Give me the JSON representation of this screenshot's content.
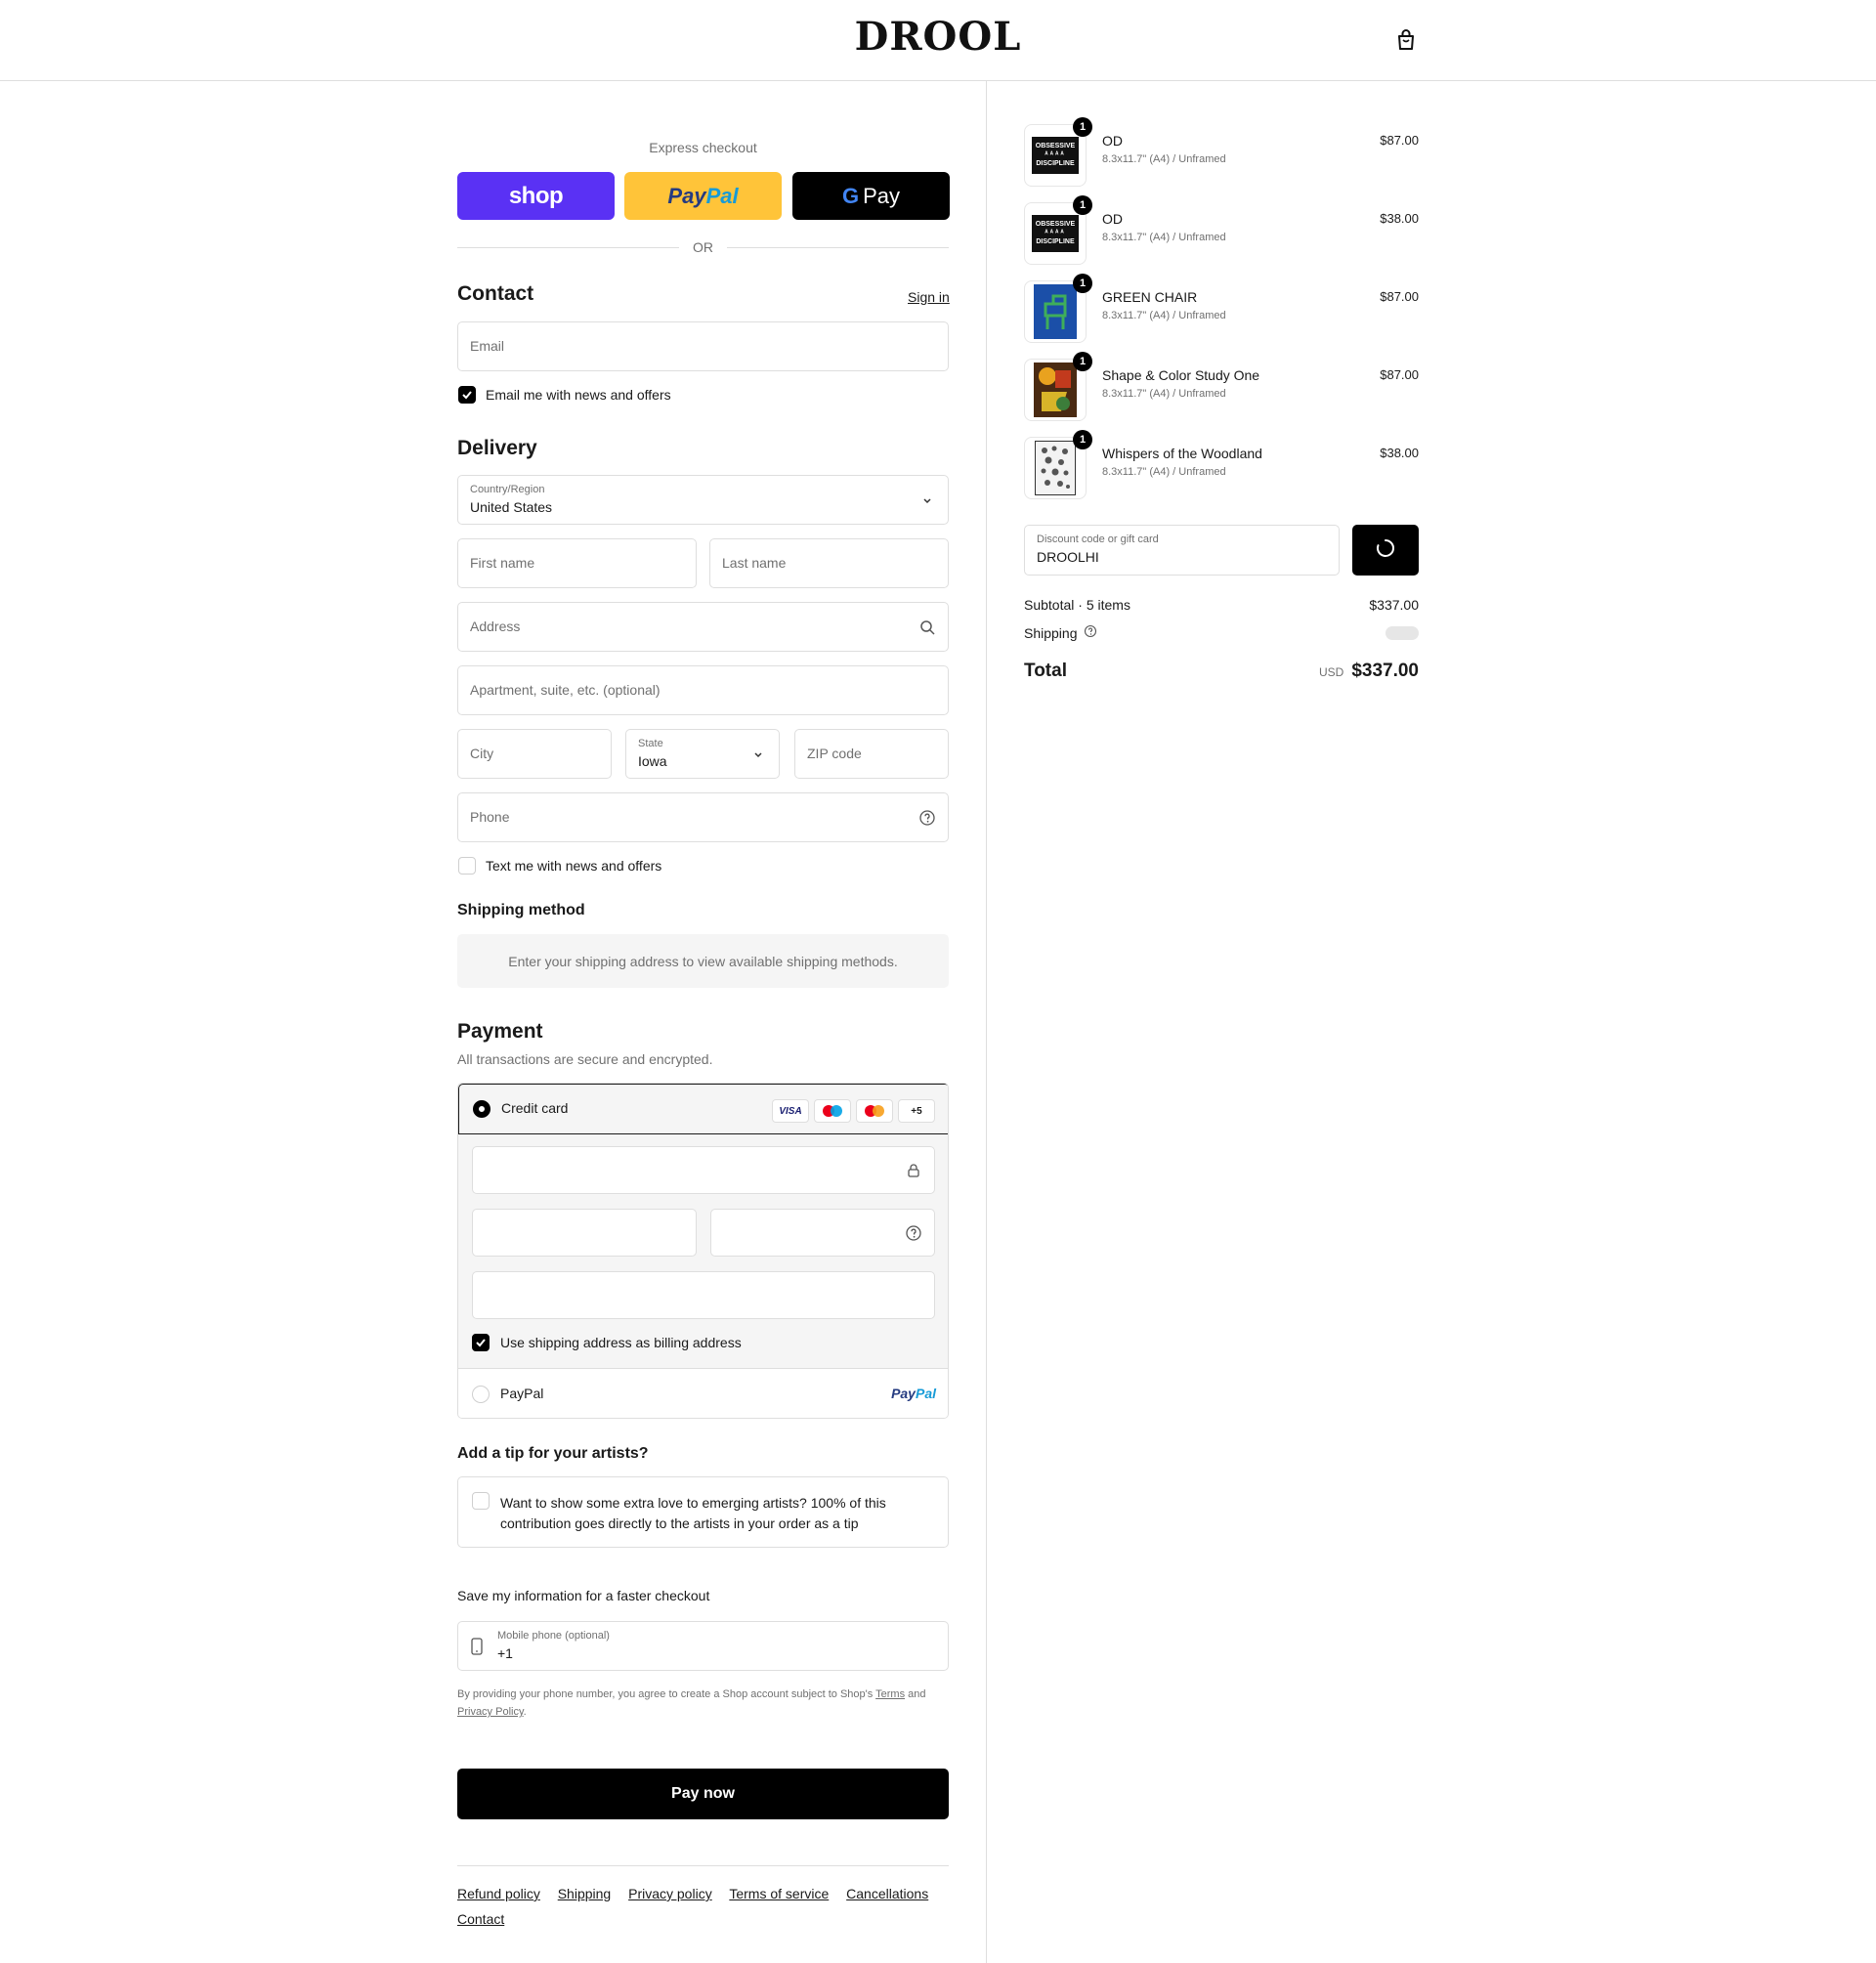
{
  "header": {
    "logo": "DROOL",
    "cart_icon": "shopping-bag-icon"
  },
  "express": {
    "label": "Express checkout",
    "shop_label": "shop",
    "paypal_a": "Pay",
    "paypal_b": "Pal",
    "gpay_g": "G",
    "gpay_label": "Pay",
    "or": "OR"
  },
  "contact": {
    "title": "Contact",
    "sign_in": "Sign in",
    "email_placeholder": "Email",
    "news_checkbox": "Email me with news and offers",
    "news_checked": true
  },
  "delivery": {
    "title": "Delivery",
    "country_label": "Country/Region",
    "country_value": "United States",
    "first_name": "First name",
    "last_name": "Last name",
    "address": "Address",
    "apartment": "Apartment, suite, etc. (optional)",
    "city": "City",
    "state_label": "State",
    "state_value": "Iowa",
    "zip": "ZIP code",
    "phone": "Phone",
    "text_checkbox": "Text me with news and offers",
    "text_checked": false
  },
  "shipping_method": {
    "title": "Shipping method",
    "note": "Enter your shipping address to view available shipping methods."
  },
  "payment": {
    "title": "Payment",
    "subtitle": "All transactions are secure and encrypted.",
    "credit_card_label": "Credit card",
    "card_logos": [
      "VISA",
      "maestro",
      "mastercard",
      "+5"
    ],
    "billing_checkbox": "Use shipping address as billing address",
    "billing_checked": true,
    "paypal_option": "PayPal",
    "paypal_logo_a": "Pay",
    "paypal_logo_b": "Pal"
  },
  "tip": {
    "title": "Add a tip for your artists?",
    "text": "Want to show some extra love to emerging artists? 100% of this contribution goes directly to the artists in your order as a tip"
  },
  "save_info": {
    "title": "Save my information for a faster checkout",
    "phone_label": "Mobile phone (optional)",
    "phone_value": "+1",
    "disclaimer_pre": "By providing your phone number, you agree to create a Shop account subject to Shop's",
    "terms": "Terms",
    "and": "and",
    "privacy": "Privacy Policy",
    "period": "."
  },
  "pay_now": "Pay now",
  "footer": {
    "links": [
      "Refund policy",
      "Shipping",
      "Privacy policy",
      "Terms of service",
      "Cancellations",
      "Contact"
    ]
  },
  "order": {
    "items": [
      {
        "qty": "1",
        "name": "OD",
        "variant": "8.3x11.7\" (A4) / Unframed",
        "price": "$87.00",
        "thumb": "obsessive-discipline-poster"
      },
      {
        "qty": "1",
        "name": "OD",
        "variant": "8.3x11.7\" (A4) / Unframed",
        "price": "$38.00",
        "thumb": "obsessive-discipline-poster"
      },
      {
        "qty": "1",
        "name": "GREEN CHAIR",
        "variant": "8.3x11.7\" (A4) / Unframed",
        "price": "$87.00",
        "thumb": "green-chair-poster"
      },
      {
        "qty": "1",
        "name": "Shape & Color Study One",
        "variant": "8.3x11.7\" (A4) / Unframed",
        "price": "$87.00",
        "thumb": "shape-color-study-poster"
      },
      {
        "qty": "1",
        "name": "Whispers of the Woodland",
        "variant": "8.3x11.7\" (A4) / Unframed",
        "price": "$38.00",
        "thumb": "woodland-poster"
      }
    ],
    "thumb_text_a": "OBSESSIVE",
    "thumb_text_b": "DISCIPLINE",
    "discount_label": "Discount code or gift card",
    "discount_value": "DROOLHI",
    "subtotal_label": "Subtotal · 5 items",
    "subtotal_value": "$337.00",
    "shipping_label": "Shipping",
    "total_label": "Total",
    "currency": "USD",
    "total_value": "$337.00"
  },
  "colors": {
    "shop": "#5a31f4",
    "paypal": "#ffc439",
    "black": "#000000",
    "muted": "#707070",
    "border": "#dedede"
  }
}
